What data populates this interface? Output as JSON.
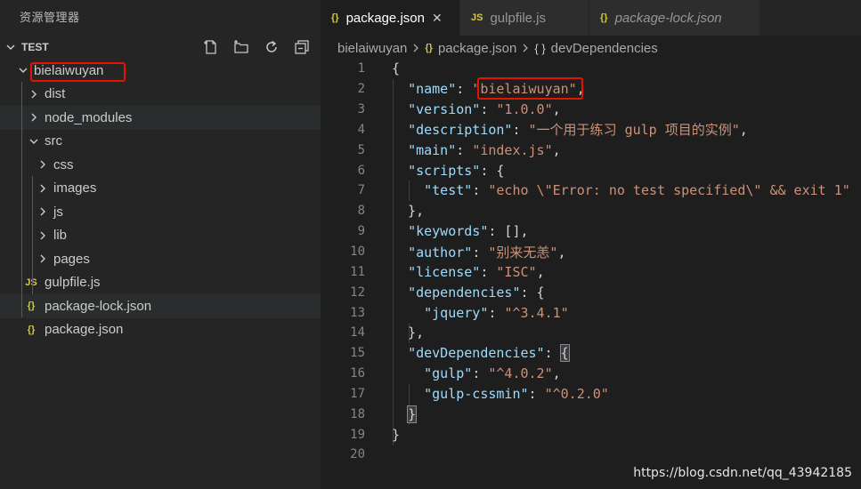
{
  "sidebar": {
    "title": "资源管理器",
    "section": "TEST",
    "actions": [
      "new-file-icon",
      "new-folder-icon",
      "refresh-icon",
      "collapse-all-icon"
    ],
    "tree": [
      {
        "label": "bielaiwuyan",
        "kind": "folder-open",
        "depth": 0
      },
      {
        "label": "dist",
        "kind": "folder",
        "depth": 1
      },
      {
        "label": "node_modules",
        "kind": "folder",
        "depth": 1
      },
      {
        "label": "src",
        "kind": "folder-open",
        "depth": 1
      },
      {
        "label": "css",
        "kind": "folder",
        "depth": 2
      },
      {
        "label": "images",
        "kind": "folder",
        "depth": 2
      },
      {
        "label": "js",
        "kind": "folder",
        "depth": 2
      },
      {
        "label": "lib",
        "kind": "folder",
        "depth": 2
      },
      {
        "label": "pages",
        "kind": "folder",
        "depth": 2
      },
      {
        "label": "gulpfile.js",
        "kind": "js",
        "depth": 1
      },
      {
        "label": "package-lock.json",
        "kind": "json",
        "depth": 1
      },
      {
        "label": "package.json",
        "kind": "json",
        "depth": 1
      }
    ]
  },
  "tabs": [
    {
      "label": "package.json",
      "icon": "{}",
      "active": true,
      "italic": false,
      "close": "✕"
    },
    {
      "label": "gulpfile.js",
      "icon": "JS",
      "active": false,
      "italic": false
    },
    {
      "label": "package-lock.json",
      "icon": "{}",
      "active": false,
      "italic": true
    }
  ],
  "breadcrumb": {
    "folder": "bielaiwuyan",
    "file": "package.json",
    "symbol": "devDependencies",
    "file_icon": "{}",
    "symbol_icon": "{ }"
  },
  "code_lines": [
    "{",
    "  \"name\": \"bielaiwuyan\",",
    "  \"version\": \"1.0.0\",",
    "  \"description\": \"一个用于练习 gulp 项目的实例\",",
    "  \"main\": \"index.js\",",
    "  \"scripts\": {",
    "    \"test\": \"echo \\\"Error: no test specified\\\" && exit 1\"",
    "  },",
    "  \"keywords\": [],",
    "  \"author\": \"别来无恙\",",
    "  \"license\": \"ISC\",",
    "  \"dependencies\": {",
    "    \"jquery\": \"^3.4.1\"",
    "  },",
    "  \"devDependencies\": {",
    "    \"gulp\": \"^4.0.2\",",
    "    \"gulp-cssmin\": \"^0.2.0\"",
    "  }",
    "}",
    ""
  ],
  "watermark": "https://blog.csdn.net/qq_43942185",
  "colors": {
    "highlight_box": "#e51400",
    "json_key": "#9cdcfe",
    "json_string": "#ce9178",
    "json_icon": "#cbcb41"
  }
}
